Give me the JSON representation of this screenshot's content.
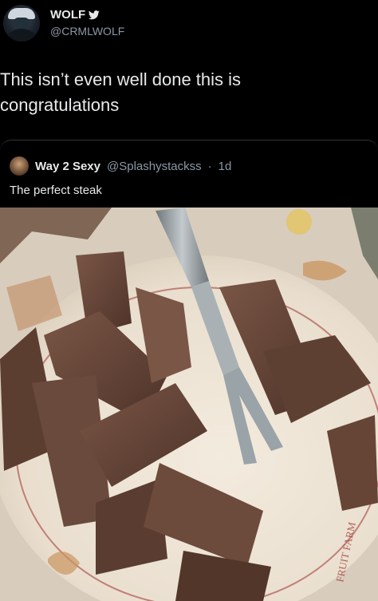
{
  "tweet": {
    "author_name": "WOLF",
    "author_handle": "@CRMLWOLF",
    "verified_symbol": "🐦",
    "text_lines": [
      "This isn’t even well done this is",
      "congratulations"
    ]
  },
  "quote": {
    "author_name": "Way 2 Sexy",
    "author_handle": "@Splashystackss",
    "separator": "·",
    "time": "1d",
    "text": "The perfect steak"
  },
  "photo": {
    "plate_text": "FRUIT FARM",
    "colors": {
      "tablecloth": "#e8ddd0",
      "plate": "#efe5d6",
      "steak": "#6b4a3b",
      "steak_dark": "#4c3228",
      "fork": "#9aa3a8"
    }
  }
}
